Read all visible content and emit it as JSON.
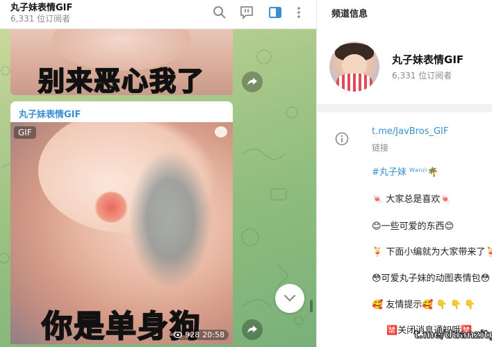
{
  "chat": {
    "title": "丸子妹表情GIF",
    "subscribers": "6,331 位订阅者",
    "top_caption": "别来恶心我了",
    "post": {
      "author": "丸子妹表情GIF",
      "badge": "GIF",
      "caption": "你是单身狗",
      "views": "928",
      "time": "20:58"
    }
  },
  "info": {
    "header": "频道信息",
    "name": "丸子妹表情GIF",
    "subscribers": "6,331 位订阅者",
    "link": "t.me/JavBros_GIF",
    "link_label": "链接",
    "desc_lines": [
      "#丸子妹 ᵂᵃⁿᶻⁱ🌴",
      "🍬 大家总是喜欢🍬",
      "😊一些可爱的东西😊",
      "🍹 下面小编就为大家带来了🍹",
      "😳可爱丸子妹的动图表情包😳",
      "🥰 友情提示🥰 👇 👇 👇",
      "🈲关闭消息通知哦🈲"
    ],
    "watermark": "t.me/duanzitg"
  },
  "icons": [
    "search-icon",
    "comments-icon",
    "sidebar-toggle-icon",
    "more-icon",
    "share-icon",
    "info-icon",
    "chevron-down-icon",
    "eye-icon"
  ],
  "colors": {
    "accent": "#3a8fd0",
    "wallpaper": "#8fbd7e"
  }
}
